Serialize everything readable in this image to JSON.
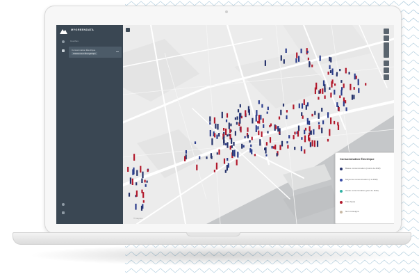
{
  "app": {
    "title": "MYGREENDATA",
    "section_label": "Couches",
    "layer_item": {
      "line1": "Consommation Électrique",
      "line2": "Classement Énergétique"
    }
  },
  "legend": {
    "title": "Consommation Électrique",
    "items": [
      {
        "label": "Basse consommation (moins de 2kW)",
        "color": "#26336b"
      },
      {
        "label": "Moyenne consommation (2 à 4kW)",
        "color": "#3a4ea8"
      },
      {
        "label": "Haute consommation (plus de 4kW)",
        "color": "#30b2a4"
      },
      {
        "label": "Très haute",
        "color": "#b2192c"
      },
      {
        "label": "Non renseigné",
        "color": "#c8b9a6"
      }
    ]
  },
  "map": {
    "attribution_left": "© Mapbox",
    "attribution_right": "© OpenStreetMap",
    "river_color": "#c5c7c9",
    "land_color": "#ececec",
    "bar_colors": [
      "#b2192c",
      "#2b3d8c",
      "#26336b"
    ]
  },
  "icons": {
    "logo": "mountain-logo-icon",
    "controls": [
      "zoom-in-icon",
      "zoom-out-icon",
      "compass-icon",
      "pitch-icon",
      "rotate-icon",
      "layers-icon"
    ]
  }
}
